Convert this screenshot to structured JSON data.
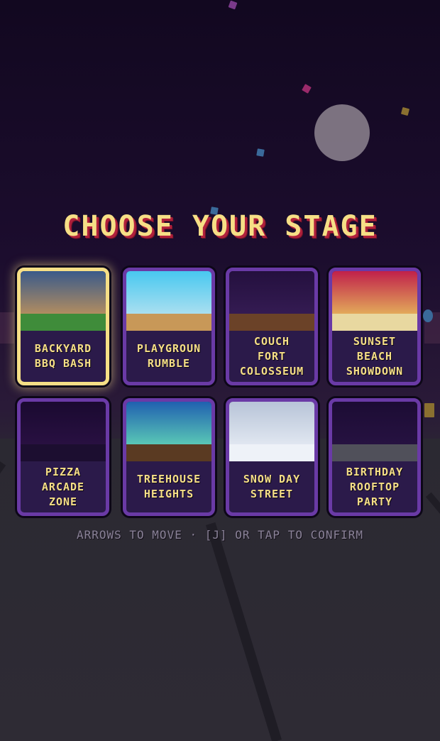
{
  "screen": {
    "title": "CHOOSE YOUR STAGE",
    "hint": "ARROWS TO MOVE · [J] OR TAP TO CONFIRM"
  },
  "stages": [
    {
      "id": "backyard-bbq-bash",
      "label": "BACKYARD\nBBQ BASH",
      "selected": true,
      "sky": [
        "#3a5a8a",
        "#e0a050"
      ],
      "ground": "#3f8c3a"
    },
    {
      "id": "playground-rumble",
      "label": "PLAYGROUN\nRUMBLE",
      "selected": false,
      "sky": [
        "#48c8f0",
        "#d0e8f0"
      ],
      "ground": "#c89858"
    },
    {
      "id": "couch-fort-colosseum",
      "label": "COUCH\nFORT\nCOLOSSEUM",
      "selected": false,
      "sky": [
        "#24103e",
        "#3a1f5a"
      ],
      "ground": "#6b4228"
    },
    {
      "id": "sunset-beach-showdown",
      "label": "SUNSET\nBEACH\nSHOWDOWN",
      "selected": false,
      "sky": [
        "#c0204a",
        "#f0e060"
      ],
      "ground": "#e8d8a0"
    },
    {
      "id": "pizza-arcade-zone",
      "label": "PIZZA\nARCADE\nZONE",
      "selected": false,
      "sky": [
        "#1a0a30",
        "#2e1248"
      ],
      "ground": "#1c0e30"
    },
    {
      "id": "treehouse-heights",
      "label": "TREEHOUSE\nHEIGHTS",
      "selected": false,
      "sky": [
        "#2060b0",
        "#70f0b8"
      ],
      "ground": "#5a3a22"
    },
    {
      "id": "snow-day-street",
      "label": "SNOW DAY\nSTREET",
      "selected": false,
      "sky": [
        "#b8c4d8",
        "#f0f4fa"
      ],
      "ground": "#eef2f8"
    },
    {
      "id": "birthday-rooftop-party",
      "label": "BIRTHDAY\nROOFTOP\nPARTY",
      "selected": false,
      "sky": [
        "#1c0c34",
        "#2a1446"
      ],
      "ground": "#50505a"
    }
  ]
}
